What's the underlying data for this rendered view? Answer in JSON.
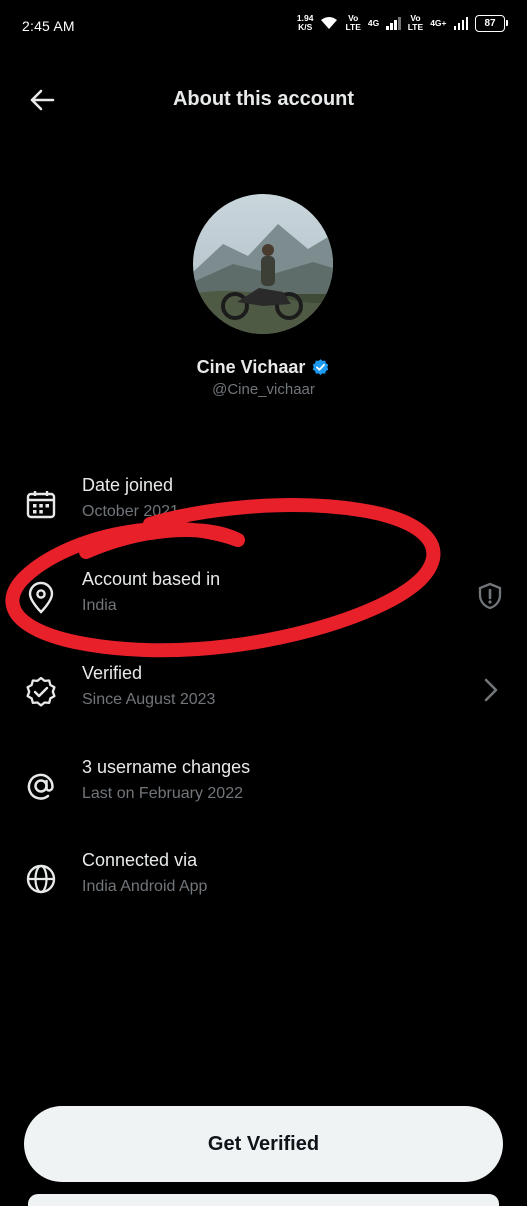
{
  "status_bar": {
    "time": "2:45 AM",
    "net_speed_value": "1.94",
    "net_speed_unit": "K/S",
    "sim1_line1": "Vo",
    "sim1_line2": "LTE",
    "sim1_type": "4G",
    "sim2_line1": "Vo",
    "sim2_line2": "LTE",
    "sim2_type": "4G+",
    "battery": "87"
  },
  "header": {
    "title": "About this account"
  },
  "profile": {
    "name": "Cine Vichaar",
    "handle": "@Cine_vichaar",
    "verified_color": "#1d9bf0"
  },
  "details": [
    {
      "label": "Date joined",
      "value": "October 2021",
      "icon": "calendar-icon"
    },
    {
      "label": "Account based in",
      "value": "India",
      "icon": "location-icon",
      "right_icon": "shield-icon"
    },
    {
      "label": "Verified",
      "value": "Since August 2023",
      "icon": "verified-badge-icon",
      "right_icon": "chevron-right-icon"
    },
    {
      "label": "3 username changes",
      "value": "Last on February 2022",
      "icon": "at-sign-icon"
    },
    {
      "label": "Connected via",
      "value": "India Android App",
      "icon": "globe-icon"
    }
  ],
  "cta": {
    "label": "Get Verified"
  },
  "colors": {
    "background": "#000000",
    "primary_text": "#e7e9ea",
    "secondary_text": "#71767b",
    "annotation": "#e8202a",
    "button_bg": "#eff3f4"
  }
}
